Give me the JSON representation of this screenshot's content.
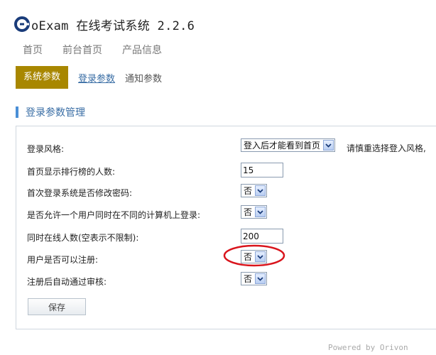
{
  "app": {
    "title": "oExam 在线考试系统 2.2.6"
  },
  "nav": [
    {
      "label": "首页"
    },
    {
      "label": "前台首页"
    },
    {
      "label": "产品信息"
    }
  ],
  "tabs": {
    "active": "系统参数",
    "items": [
      {
        "label": "登录参数"
      },
      {
        "label": "通知参数"
      }
    ]
  },
  "section": {
    "title": "登录参数管理"
  },
  "form": {
    "rows": [
      {
        "label": "登录风格:",
        "value": "登入后才能看到首页",
        "hint": "请慎重选择登入风格,"
      },
      {
        "label": "首页显示排行榜的人数:",
        "value": "15"
      },
      {
        "label": "首次登录系统是否修改密码:",
        "value": "否"
      },
      {
        "label": "是否允许一个用户同时在不同的计算机上登录:",
        "value": "否"
      },
      {
        "label": "同时在线人数(空表示不限制):",
        "value": "200"
      },
      {
        "label": "用户是否可以注册:",
        "value": "否"
      },
      {
        "label": "注册后自动通过审核:",
        "value": "否"
      }
    ],
    "save_label": "保存"
  },
  "footer": "Powered by Orivon",
  "colors": {
    "accent": "#a88700",
    "link": "#3a6ea5",
    "section_bar": "#4a8fd6",
    "annotation": "#d9141c"
  }
}
